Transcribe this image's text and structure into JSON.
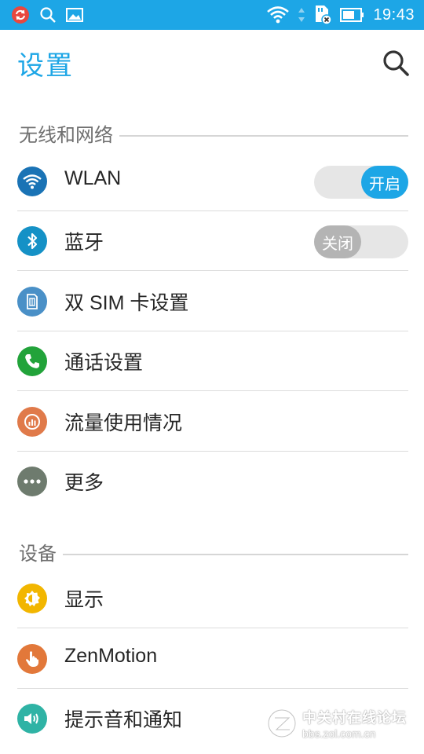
{
  "status_bar": {
    "time": "19:43",
    "icons": [
      "sync-icon",
      "search-icon",
      "gallery-icon",
      "wifi-icon",
      "data-arrows-icon",
      "sim-card-off-icon",
      "battery-icon"
    ]
  },
  "header": {
    "title": "设置",
    "search_icon": "search-icon"
  },
  "sections": [
    {
      "title": "无线和网络",
      "items": [
        {
          "label": "WLAN",
          "icon": "wifi-icon",
          "color": "#1a73b5",
          "toggle": {
            "state": "on",
            "label": "开启"
          }
        },
        {
          "label": "蓝牙",
          "icon": "bluetooth-icon",
          "color": "#1591c6",
          "toggle": {
            "state": "off",
            "label": "关闭"
          }
        },
        {
          "label": "双 SIM 卡设置",
          "icon": "sim-card-icon",
          "color": "#4a90c7"
        },
        {
          "label": "通话设置",
          "icon": "phone-icon",
          "color": "#22a33a"
        },
        {
          "label": "流量使用情况",
          "icon": "data-usage-icon",
          "color": "#e07a4a"
        },
        {
          "label": "更多",
          "icon": "more-icon",
          "color": "#6e7b6e"
        }
      ]
    },
    {
      "title": "设备",
      "items": [
        {
          "label": "显示",
          "icon": "display-brightness-icon",
          "color": "#f2b600"
        },
        {
          "label": "ZenMotion",
          "icon": "zenmotion-hand-icon",
          "color": "#e2783a"
        },
        {
          "label": "提示音和通知",
          "icon": "sound-icon",
          "color": "#2fb3a5"
        }
      ]
    }
  ],
  "watermark": {
    "line1": "中关村在线论坛",
    "line2": "bbs.zol.com.cn"
  }
}
